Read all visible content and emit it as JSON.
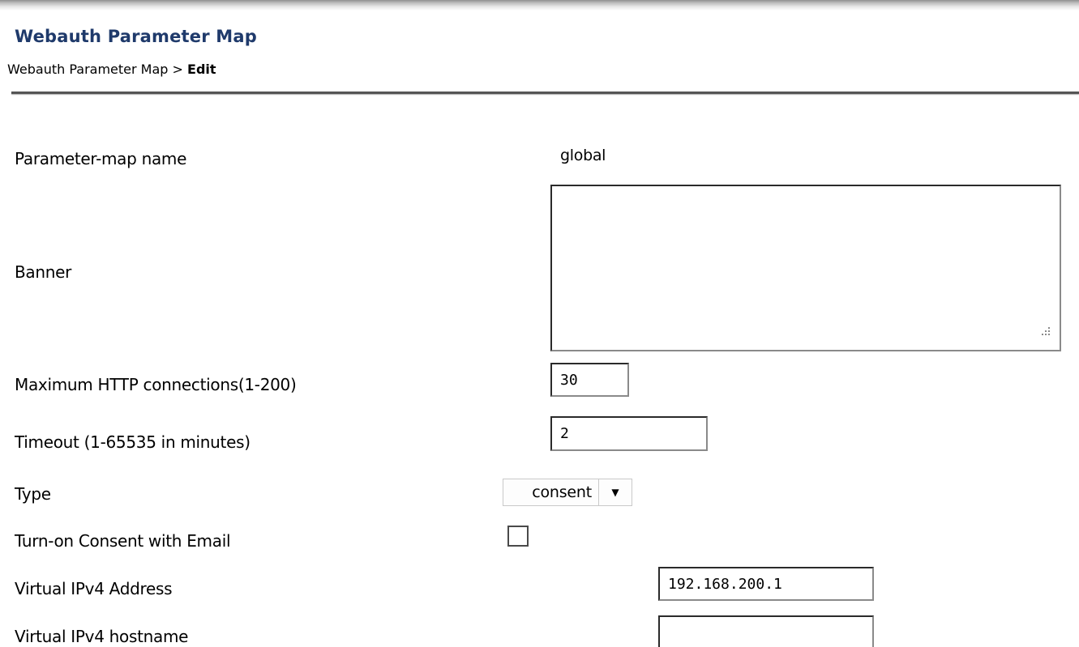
{
  "header": {
    "title": "Webauth Parameter Map",
    "breadcrumb": {
      "parent": "Webauth Parameter Map",
      "separator": ">",
      "current": "Edit"
    }
  },
  "form": {
    "parameter_map_name": {
      "label": "Parameter-map name",
      "value": "global"
    },
    "banner": {
      "label": "Banner",
      "value": ""
    },
    "max_http_connections": {
      "label": "Maximum HTTP connections(1-200)",
      "value": "30"
    },
    "timeout": {
      "label": "Timeout (1-65535 in minutes)",
      "value": "2"
    },
    "type": {
      "label": "Type",
      "selected": "consent",
      "icon": "caret-down-icon"
    },
    "consent_with_email": {
      "label": "Turn-on Consent with Email",
      "checked": false
    },
    "virtual_ipv4_address": {
      "label": "Virtual IPv4 Address",
      "value": "192.168.200.1"
    },
    "virtual_ipv4_hostname": {
      "label": "Virtual IPv4 hostname",
      "value": ""
    }
  },
  "colors": {
    "title": "#1f3a6b",
    "divider": "#555555"
  }
}
